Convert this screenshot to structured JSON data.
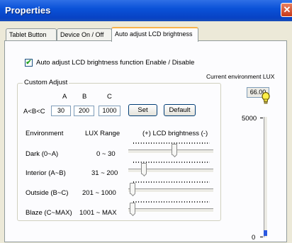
{
  "window": {
    "title": "Properties",
    "close_glyph": "✕"
  },
  "tabs": [
    {
      "label": "Tablet Button",
      "active": false
    },
    {
      "label": "Device On / Off",
      "active": false
    },
    {
      "label": "Auto adjust LCD brightness",
      "active": true
    }
  ],
  "auto_adjust": {
    "checked": true,
    "check_glyph": "✔",
    "label": "Auto adjust LCD brightness function Enable / Disable"
  },
  "current_lux": {
    "label": "Current environment LUX",
    "value": "66.00"
  },
  "custom_adjust": {
    "title": "Custom Adjust",
    "constraint_label": "A<B<C",
    "columns": [
      "A",
      "B",
      "C"
    ],
    "values": [
      "30",
      "200",
      "1000"
    ],
    "set_label": "Set",
    "default_label": "Default"
  },
  "table": {
    "headers": {
      "environment": "Environment",
      "lux_range": "LUX Range",
      "brightness": "(+) LCD brightness (-)"
    },
    "rows": [
      {
        "environment": "Dark (0~A)",
        "range": "0 ~ 30",
        "level": 0.55
      },
      {
        "environment": "Interior (A~B)",
        "range": "31 ~ 200",
        "level": 0.15
      },
      {
        "environment": "Outside (B~C)",
        "range": "201 ~ 1000",
        "level": 0.0
      },
      {
        "environment": "Blaze (C~MAX)",
        "range": "1001 ~ MAX",
        "level": 0.0
      }
    ]
  },
  "lux_meter": {
    "max_label": "5000",
    "min_label": "0",
    "current_lux": 66,
    "max_lux": 5000,
    "bulb_icon": "lightbulb-icon",
    "fill_color": "#2a58e0"
  }
}
